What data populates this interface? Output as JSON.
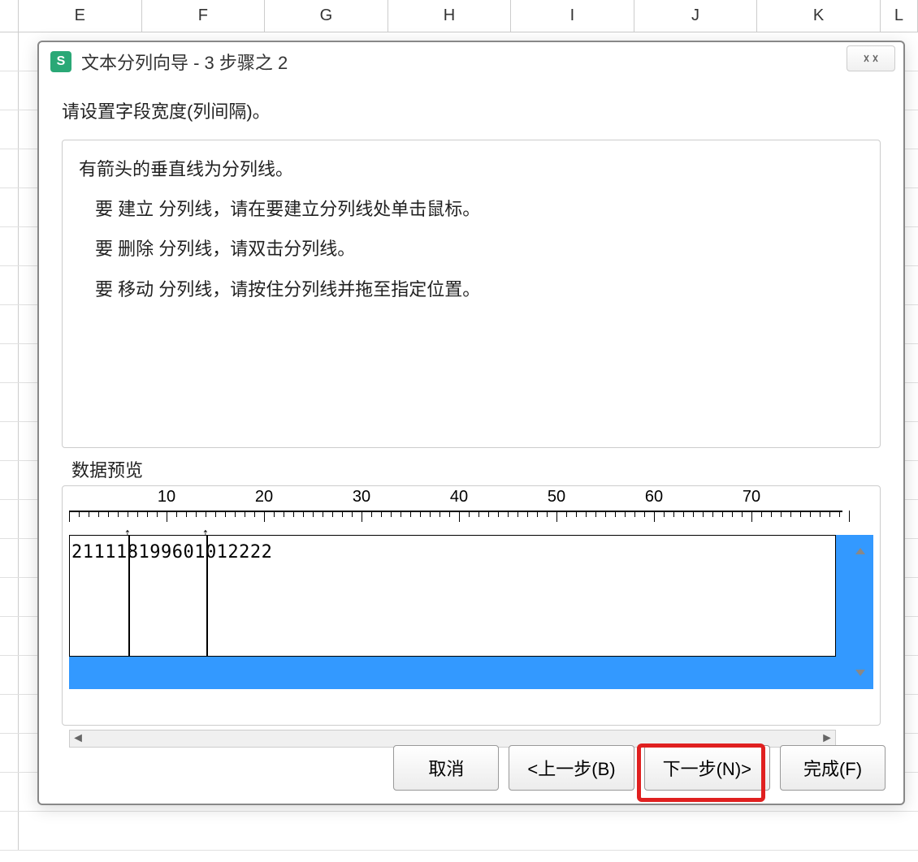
{
  "columns": [
    "E",
    "F",
    "G",
    "H",
    "I",
    "J",
    "K",
    "L"
  ],
  "dialog": {
    "title": "文本分列向导 - 3 步骤之 2",
    "instruction": "请设置字段宽度(列间隔)。",
    "help": {
      "line1": "有箭头的垂直线为分列线。",
      "line2": "要 建立 分列线，请在要建立分列线处单击鼠标。",
      "line3": "要 删除 分列线，请双击分列线。",
      "line4": "要 移动 分列线，请按住分列线并拖至指定位置。"
    },
    "preview": {
      "label": "数据预览",
      "ruler_ticks": [
        10,
        20,
        30,
        40,
        50,
        60,
        70
      ],
      "data_text": "211118199601012222",
      "break_positions": [
        6,
        14
      ]
    },
    "buttons": {
      "cancel": "取消",
      "back": "<上一步(B)",
      "next": "下一步(N)>",
      "finish": "完成(F)"
    }
  }
}
